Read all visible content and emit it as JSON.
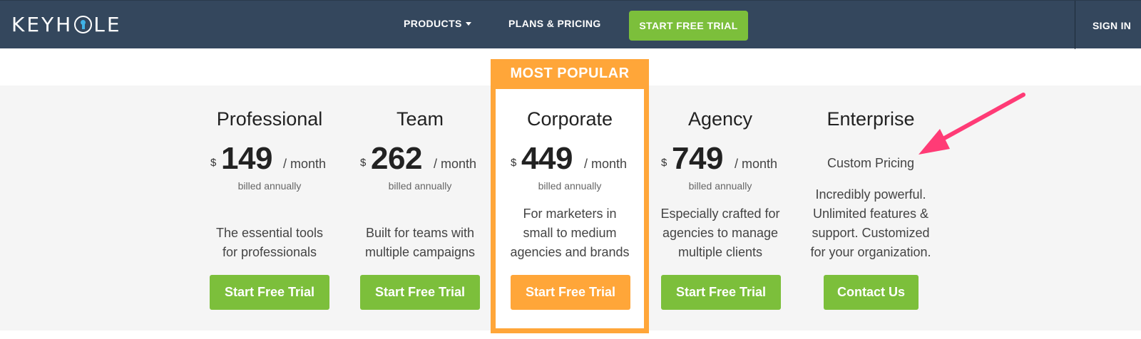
{
  "nav": {
    "logo_text": "KEYHOLE",
    "products_label": "PRODUCTS",
    "plans_label": "PLANS & PRICING",
    "cta_label": "START FREE TRIAL",
    "signin_label": "SIGN IN"
  },
  "featured_badge": "MOST POPULAR",
  "plans": [
    {
      "name": "Professional",
      "currency": "$",
      "price": "149",
      "period": "/ month",
      "billing": "billed annually",
      "description": [
        "The essential tools",
        "for professionals"
      ],
      "cta": "Start Free Trial"
    },
    {
      "name": "Team",
      "currency": "$",
      "price": "262",
      "period": "/ month",
      "billing": "billed annually",
      "description": [
        "Built for teams with",
        "multiple campaigns"
      ],
      "cta": "Start Free Trial"
    },
    {
      "name": "Corporate",
      "currency": "$",
      "price": "449",
      "period": "/ month",
      "billing": "billed annually",
      "description": [
        "For marketers in",
        "small to medium",
        "agencies and brands"
      ],
      "cta": "Start Free Trial"
    },
    {
      "name": "Agency",
      "currency": "$",
      "price": "749",
      "period": "/ month",
      "billing": "billed annually",
      "description": [
        "Especially crafted for",
        "agencies to manage",
        "multiple clients"
      ],
      "cta": "Start Free Trial"
    },
    {
      "name": "Enterprise",
      "pricing_text": "Custom Pricing",
      "description": [
        "Incredibly powerful.",
        "Unlimited features &",
        "support. Customized",
        "for your organization."
      ],
      "cta": "Contact Us"
    }
  ],
  "colors": {
    "nav_bg": "#34475d",
    "green": "#7cbf3b",
    "orange": "#ffa639",
    "arrow_pink": "#ff3b76"
  }
}
